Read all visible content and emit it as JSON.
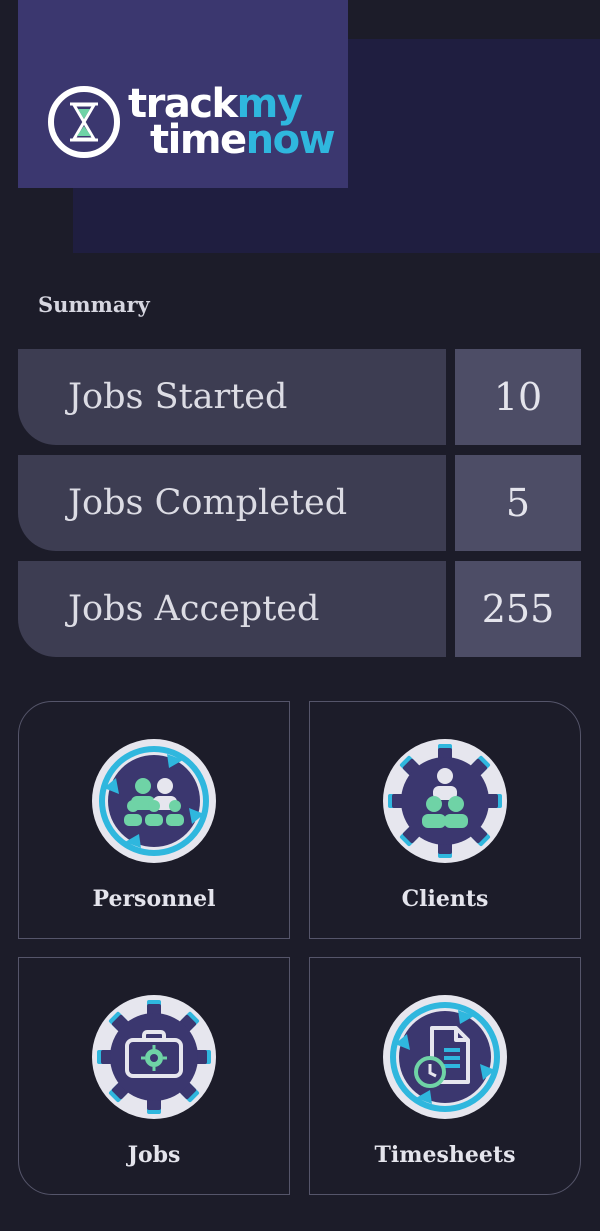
{
  "brand": {
    "logo_line1_a": "track",
    "logo_line1_b": "my",
    "logo_line2_a": "time",
    "logo_line2_b": "now"
  },
  "summary": {
    "title": "Summary",
    "rows": [
      {
        "label": "Jobs Started",
        "value": "10"
      },
      {
        "label": "Jobs Completed",
        "value": "5"
      },
      {
        "label": "Jobs Accepted",
        "value": "255"
      }
    ]
  },
  "tiles": [
    {
      "label": "Personnel",
      "icon": "personnel-icon"
    },
    {
      "label": "Clients",
      "icon": "clients-icon"
    },
    {
      "label": "Jobs",
      "icon": "jobs-icon"
    },
    {
      "label": "Timesheets",
      "icon": "timesheets-icon"
    }
  ],
  "colors": {
    "background": "#1c1c29",
    "accent": "#2fb7de",
    "green": "#6fd3a6",
    "purple": "#3b376f"
  }
}
